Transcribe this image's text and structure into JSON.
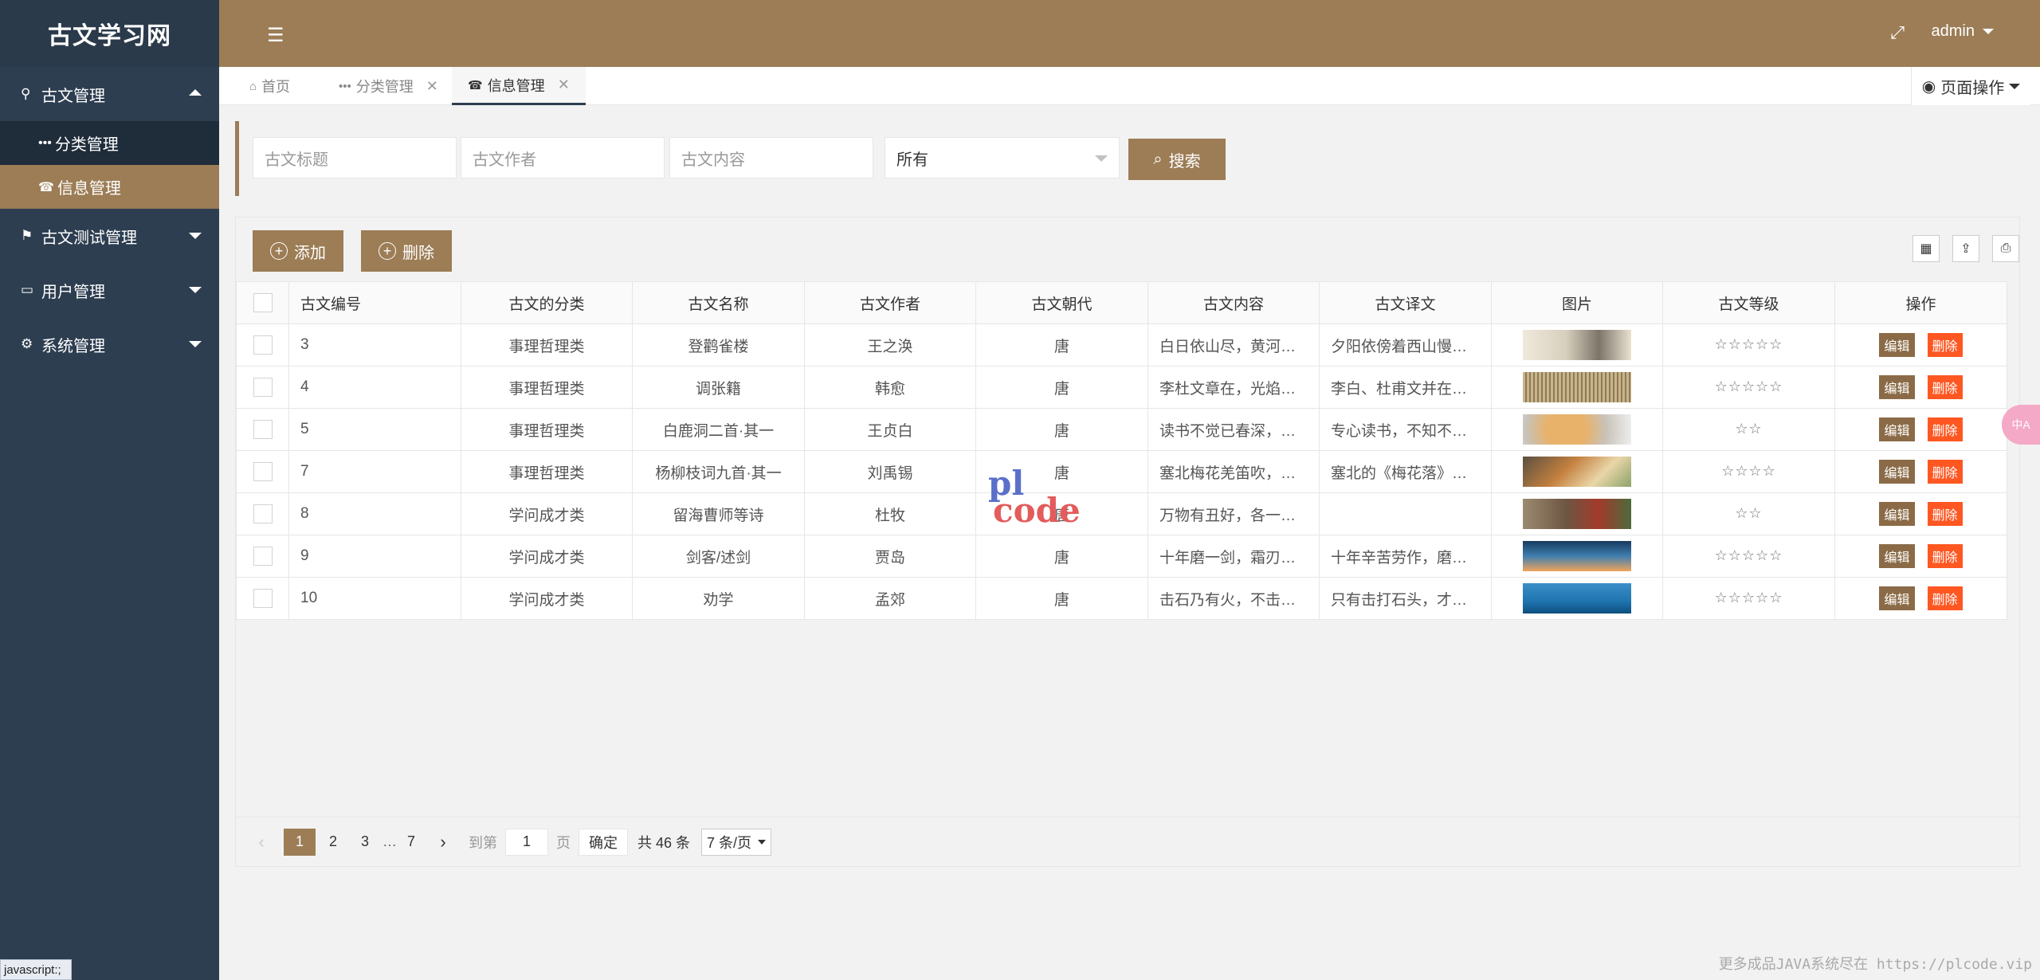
{
  "app": {
    "title": "古文学习网"
  },
  "sidebar": {
    "groups": [
      {
        "label": "古文管理",
        "icon": "user-icon",
        "expanded": true,
        "items": [
          {
            "label": "分类管理",
            "icon": "dots-icon"
          },
          {
            "label": "信息管理",
            "icon": "card-icon",
            "active": true
          }
        ]
      },
      {
        "label": "古文测试管理",
        "icon": "flag-icon"
      },
      {
        "label": "用户管理",
        "icon": "monitor-icon"
      },
      {
        "label": "系统管理",
        "icon": "gears-icon"
      }
    ]
  },
  "header": {
    "user": "admin"
  },
  "tabs": [
    {
      "label": "首页",
      "icon": "home-icon"
    },
    {
      "label": "分类管理",
      "icon": "dots-icon"
    },
    {
      "label": "信息管理",
      "icon": "card-icon",
      "active": true
    }
  ],
  "page_ops": "页面操作",
  "search": {
    "title_placeholder": "古文标题",
    "author_placeholder": "古文作者",
    "content_placeholder": "古文内容",
    "select_value": "所有",
    "button": "搜索"
  },
  "toolbar": {
    "add": "添加",
    "delete": "删除"
  },
  "table": {
    "headers": [
      "古文编号",
      "古文的分类",
      "古文名称",
      "古文作者",
      "古文朝代",
      "古文内容",
      "古文译文",
      "图片",
      "古文等级",
      "操作"
    ],
    "edit_label": "编辑",
    "delete_label": "删除",
    "rows": [
      {
        "id": "3",
        "category": "事理哲理类",
        "name": "登鹳雀楼",
        "author": "王之涣",
        "dynasty": "唐",
        "content": "白日依山尽，黄河入海流。",
        "translation": "夕阳依傍着西山慢慢地沉没",
        "level": "☆☆☆☆☆",
        "img": "ink-landscape"
      },
      {
        "id": "4",
        "category": "事理哲理类",
        "name": "调张籍",
        "author": "韩愈",
        "dynasty": "唐",
        "content": "李杜文章在，光焰万丈长。",
        "translation": "李白、杜甫文并在，光芒万丈",
        "level": "☆☆☆☆☆",
        "img": "calligraphy"
      },
      {
        "id": "5",
        "category": "事理哲理类",
        "name": "白鹿洞二首·其一",
        "author": "王贞白",
        "dynasty": "唐",
        "content": "读书不觉已春深，一寸光阴",
        "translation": "专心读书，不知不觉春天已经",
        "level": "☆☆",
        "img": "food"
      },
      {
        "id": "7",
        "category": "事理哲理类",
        "name": "杨柳枝词九首·其一",
        "author": "刘禹锡",
        "dynasty": "唐",
        "content": "塞北梅花羌笛吹，淮南桂树",
        "translation": "塞北的《梅花落》是羌笛吹奏",
        "level": "☆☆☆☆",
        "img": "food2"
      },
      {
        "id": "8",
        "category": "学问成才类",
        "name": "留海曹师等诗",
        "author": "杜牧",
        "dynasty": "唐",
        "content": "万物有丑好，各一姿态",
        "translation": "",
        "level": "☆☆",
        "img": "food3"
      },
      {
        "id": "9",
        "category": "学问成才类",
        "name": "剑客/述剑",
        "author": "贾岛",
        "dynasty": "唐",
        "content": "十年磨一剑，霜刃未曾试。",
        "translation": "十年辛苦劳作，磨出一把宝剑",
        "level": "☆☆☆☆☆",
        "img": "sky"
      },
      {
        "id": "10",
        "category": "学问成才类",
        "name": "劝学",
        "author": "孟郊",
        "dynasty": "唐",
        "content": "击石乃有火，不击元无烟。",
        "translation": "只有击打石头，才会有火花",
        "level": "☆☆☆☆☆",
        "img": "sea"
      }
    ]
  },
  "pager": {
    "pages": [
      "1",
      "2",
      "3",
      "…",
      "7"
    ],
    "current": "1",
    "goto_label": "到第",
    "goto_value": "1",
    "page_unit": "页",
    "confirm": "确定",
    "total": "共 46 条",
    "page_size": "7 条/页"
  },
  "status_bar": "javascript:;",
  "footer": "更多成品JAVA系统尽在 https://plcode.vip",
  "watermark": {
    "line1": "pl",
    "line2": "code"
  },
  "side_badge": "中A"
}
